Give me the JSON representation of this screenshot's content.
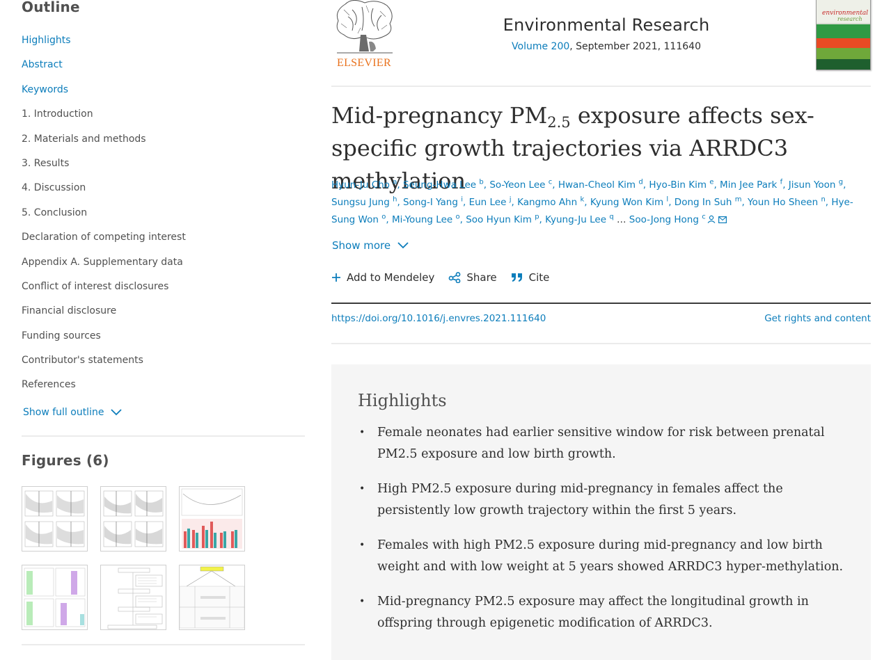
{
  "sidebar": {
    "outline_title": "Outline",
    "outline_items": [
      {
        "label": "Highlights",
        "link": true
      },
      {
        "label": "Abstract",
        "link": true
      },
      {
        "label": "Keywords",
        "link": true
      },
      {
        "label": "1. Introduction",
        "link": false
      },
      {
        "label": "2. Materials and methods",
        "link": false
      },
      {
        "label": "3. Results",
        "link": false
      },
      {
        "label": "4. Discussion",
        "link": false
      },
      {
        "label": "5. Conclusion",
        "link": false
      },
      {
        "label": "Declaration of competing interest",
        "link": false
      },
      {
        "label": "Appendix A. Supplementary data",
        "link": false
      },
      {
        "label": "Conflict of interest disclosures",
        "link": false
      },
      {
        "label": "Financial disclosure",
        "link": false
      },
      {
        "label": "Funding sources",
        "link": false
      },
      {
        "label": "Contributor's statements",
        "link": false
      },
      {
        "label": "References",
        "link": false
      }
    ],
    "show_full_outline": "Show full outline",
    "figures_title": "Figures (6)"
  },
  "journal": {
    "publisher": "ELSEVIER",
    "name": "Environmental Research",
    "volume_link": "Volume 200",
    "issue_details": ", September 2021, 111640",
    "cover_text": "environmental research",
    "accent_color": "#0c7dbb",
    "publisher_color": "#e9711c"
  },
  "article": {
    "title_pre": "Mid-pregnancy PM",
    "title_sub": "2.5",
    "title_post": " exposure affects sex-specific growth trajectories via ARRDC3 methylation",
    "authors": [
      {
        "name": "Hyun-Ju Cho",
        "aff": "a"
      },
      {
        "name": "Seung-Hwa Lee",
        "aff": "b"
      },
      {
        "name": "So-Yeon Lee",
        "aff": "c"
      },
      {
        "name": "Hwan-Cheol Kim",
        "aff": "d"
      },
      {
        "name": "Hyo-Bin Kim",
        "aff": "e"
      },
      {
        "name": "Min Jee Park",
        "aff": "f"
      },
      {
        "name": "Jisun Yoon",
        "aff": "g"
      },
      {
        "name": "Sungsu Jung",
        "aff": "h"
      },
      {
        "name": "Song-I Yang",
        "aff": "i"
      },
      {
        "name": "Eun Lee",
        "aff": "j"
      },
      {
        "name": "Kangmo Ahn",
        "aff": "k"
      },
      {
        "name": "Kyung Won Kim",
        "aff": "l"
      },
      {
        "name": "Dong In Suh",
        "aff": "m"
      },
      {
        "name": "Youn Ho Sheen",
        "aff": "n"
      },
      {
        "name": "Hye-Sung Won",
        "aff": "o"
      },
      {
        "name": "Mi-Young Lee",
        "aff": "o"
      },
      {
        "name": "Soo Hyun Kim",
        "aff": "p"
      },
      {
        "name": "Kyung-Ju Lee",
        "aff": "q"
      }
    ],
    "ellipsis": "…",
    "corresponding_author": {
      "name": "Soo-Jong Hong",
      "aff": "c"
    },
    "show_more": "Show more",
    "actions": {
      "mendeley": "Add to Mendeley",
      "share": "Share",
      "cite": "Cite"
    },
    "doi": "https://doi.org/10.1016/j.envres.2021.111640",
    "rights": "Get rights and content"
  },
  "highlights": {
    "title": "Highlights",
    "items": [
      "Female neonates had earlier sensitive window for risk between prenatal PM2.5 exposure and low birth growth.",
      "High PM2.5 exposure during mid-pregnancy in females affect the persistently low growth trajectory within the first 5 years.",
      "Females with high PM2.5 exposure during mid-pregnancy and low birth weight and with low weight at 5 years showed ARRDC3 hyper-methylation.",
      "Mid-pregnancy PM2.5 exposure may affect the longitudinal growth in offspring through epigenetic modification of ARRDC3."
    ]
  }
}
